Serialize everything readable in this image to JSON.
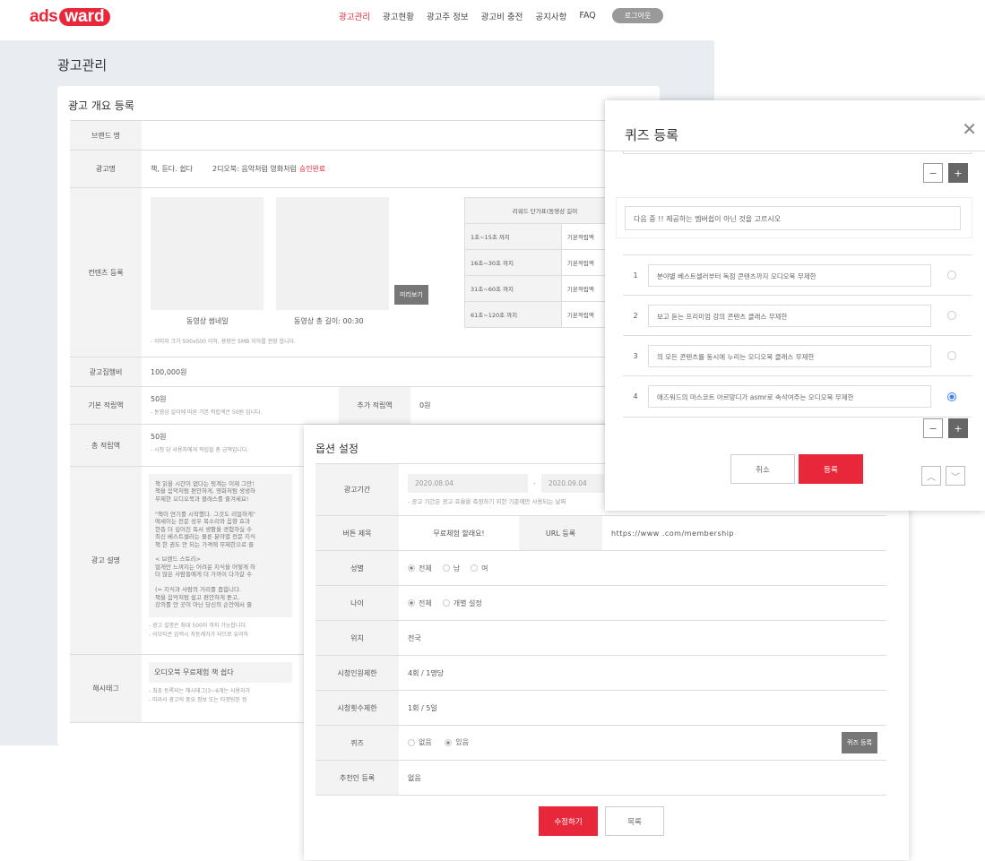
{
  "header": {
    "logo_prefix": "ads",
    "logo_suffix": "ward",
    "nav": [
      "광고관리",
      "광고현황",
      "광고주 정보",
      "광고비 충전",
      "공지사항",
      "FAQ"
    ],
    "logout": "로그아웃"
  },
  "page": {
    "title": "광고관리",
    "section_title": "광고 개요 등록"
  },
  "form": {
    "brand_label": "브랜드 명",
    "brand_value": "",
    "adname_label": "광고명",
    "adname_value": "책, 듣다. 쉽다",
    "adname_value2": "2디오북: 음악처럼 영화처럼",
    "adname_status": "승인완료",
    "content_label": "컨텐츠 등록",
    "thumb_label": "동영상 썸네일",
    "video_label": "동영상 총 길이: 00:30",
    "preview_btn": "미리보기",
    "content_note": "- 이미지 크기 500x500 이하, 용량은 5MB 이하를 권장 합니다.",
    "reward_header": "리워드 단가표(동영상 길이",
    "reward_rows": [
      {
        "range": "1초~15초 까지",
        "value": "기본적립액"
      },
      {
        "range": "16초~30초 까지",
        "value": "기본적립액"
      },
      {
        "range": "31초~60초 까지",
        "value": "기본적립액"
      },
      {
        "range": "61초~120초 까지",
        "value": "기본적립액"
      }
    ],
    "budget_label": "광고집행비",
    "budget_value": "100,000원",
    "base_label": "기본 적립액",
    "base_value": "50원",
    "base_note": "- 동영상 길이에 따른 기본 적립액은 50원 입니다.",
    "extra_label": "추가 적립액",
    "extra_value": "0원",
    "total_label": "총 적립액",
    "total_value": "50원",
    "total_note": "- 시청 당 사용자에게 적립될 총 금액입니다.",
    "desc_label": "광고 설명",
    "desc_text": "책 읽을 시간이 없다는 핑계는 이제 그만!\n책을 음악처럼 편안하게, 영화처럼 생생하\n무제한 오디오북과 클래스를 즐겨세요!\n\n\"책이 연기를 시작했다. 그것도 리얼하게\"\n에세이는 전문 성우 목소리와 음향 효과\n한층 더 깊어진 독서 생활을 경험하실 수 \n최신 베스트셀러는 물론 분야별 전문 지식\n책 한 권도 안 되는 가격에 무제한으로 즐\n\n<      브랜드 스토리>\n멀게만 느껴지는 어려운 지식을 어떻게 하\n더 많은 사람들에게 더 가까이 다가갈 수 \n\n(= 지식과 사람의 거리를 좁힙니다.\n책을 음악처럼 쉽고 편안하게 듣고,\n강의를 안 곳이 아닌 당신의 손안에서 즐",
    "desc_note1": "- 광고 설명은 최대 500자 까지 가능합니다.",
    "desc_note2": "- 이모티콘 입력시 자동제거가 되므로 유의하",
    "hashtag_label": "해시태그",
    "hashtag_value": "오디오북 무료체험 책 쉽다",
    "hashtag_note1": "- 최초 등록되는 해시태그(3~6개는 사용자가",
    "hashtag_note2": "- 따라서 광고의 중요 정보 또는 타겟팅된 정"
  },
  "options": {
    "title": "옵션 설정",
    "period_label": "광고기간",
    "date_start": "2020.08.04",
    "date_sep": "-",
    "date_end": "2020.09.04",
    "period_note": "- 광고 기간은 광고 효율을 측정하기 위한 기준에만 사용되는 날짜",
    "btn_title_label": "버튼 제목",
    "btn_title_value": "무료체험 할래요!",
    "url_label": "URL 등록",
    "url_value": "https://www          .com/membership",
    "gender_label": "성별",
    "gender_opts": [
      "전체",
      "남",
      "여"
    ],
    "age_label": "나이",
    "age_opts": [
      "전체",
      "개별 설정"
    ],
    "location_label": "위치",
    "location_value": "전국",
    "limit_label": "시청인원제한",
    "limit_value": "4회 / 1명당",
    "count_label": "시청횟수제한",
    "count_value": "1회 / 5일",
    "quiz_label": "퀴즈",
    "quiz_opts": [
      "없음",
      "있음"
    ],
    "quiz_btn": "퀴즈 등록",
    "ref_label": "추천인 등록",
    "ref_value": "없음",
    "submit_btn": "수정하기",
    "list_btn": "목록"
  },
  "quiz": {
    "title": "퀴즈 등록",
    "question": "다음 중        !! 제공하는 멤버쉽이 아닌 것을 고르시오",
    "answers": [
      {
        "num": "1",
        "text": "분야별 베스트셀러부터 독점 콘텐츠까지 오디오북 무제한"
      },
      {
        "num": "2",
        "text": "보고 듣는 프리미엄 강의 콘텐츠 클래스 무제한"
      },
      {
        "num": "3",
        "text": "     의 모든 콘텐츠를 동시에 누리는 오디오북 클래스 무제한"
      },
      {
        "num": "4",
        "text": "애즈워드의 마스코트 아르망디가 asmr로 속삭여주는 오디오북 무제한"
      }
    ],
    "selected_answer": 4,
    "minus": "−",
    "plus": "+",
    "cancel_btn": "취소",
    "register_btn": "등록"
  }
}
